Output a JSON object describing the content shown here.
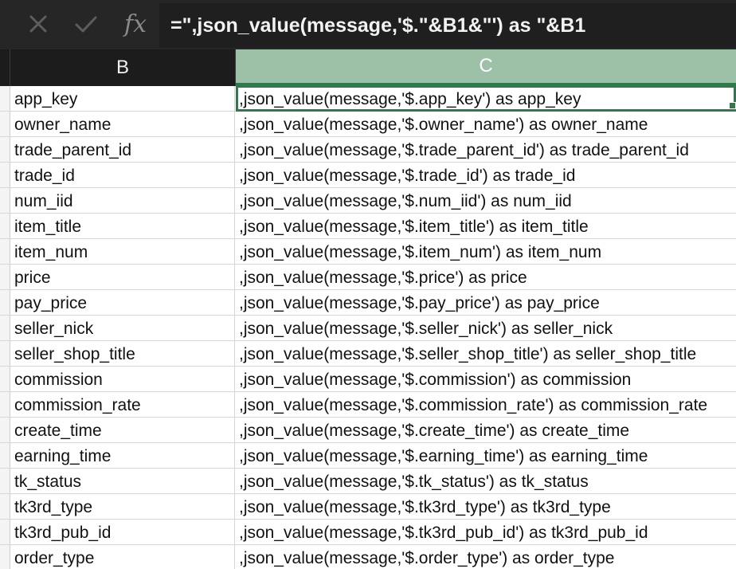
{
  "formula_bar": {
    "cancel_icon": "x-icon",
    "confirm_icon": "check-icon",
    "fx_label": "fx",
    "formula": "=\",json_value(message,'$.\"&B1&\"') as \"&B1"
  },
  "columns": {
    "b": "B",
    "c": "C"
  },
  "selected_cell": "C1",
  "rows": [
    {
      "b": "app_key",
      "c": ",json_value(message,'$.app_key') as app_key"
    },
    {
      "b": "owner_name",
      "c": ",json_value(message,'$.owner_name') as owner_name"
    },
    {
      "b": "trade_parent_id",
      "c": ",json_value(message,'$.trade_parent_id') as trade_parent_id"
    },
    {
      "b": "trade_id",
      "c": ",json_value(message,'$.trade_id') as trade_id"
    },
    {
      "b": "num_iid",
      "c": ",json_value(message,'$.num_iid') as num_iid"
    },
    {
      "b": "item_title",
      "c": ",json_value(message,'$.item_title') as item_title"
    },
    {
      "b": "item_num",
      "c": ",json_value(message,'$.item_num') as item_num"
    },
    {
      "b": "price",
      "c": ",json_value(message,'$.price') as price"
    },
    {
      "b": "pay_price",
      "c": ",json_value(message,'$.pay_price') as pay_price"
    },
    {
      "b": "seller_nick",
      "c": ",json_value(message,'$.seller_nick') as seller_nick"
    },
    {
      "b": "seller_shop_title",
      "c": ",json_value(message,'$.seller_shop_title') as seller_shop_title"
    },
    {
      "b": "commission",
      "c": ",json_value(message,'$.commission') as commission"
    },
    {
      "b": "commission_rate",
      "c": ",json_value(message,'$.commission_rate') as commission_rate"
    },
    {
      "b": "create_time",
      "c": ",json_value(message,'$.create_time') as create_time"
    },
    {
      "b": "earning_time",
      "c": ",json_value(message,'$.earning_time') as earning_time"
    },
    {
      "b": "tk_status",
      "c": ",json_value(message,'$.tk_status') as tk_status"
    },
    {
      "b": "tk3rd_type",
      "c": ",json_value(message,'$.tk3rd_type') as tk3rd_type"
    },
    {
      "b": "tk3rd_pub_id",
      "c": ",json_value(message,'$.tk3rd_pub_id') as tk3rd_pub_id"
    },
    {
      "b": "order_type",
      "c": ",json_value(message,'$.order_type') as order_type"
    }
  ]
}
